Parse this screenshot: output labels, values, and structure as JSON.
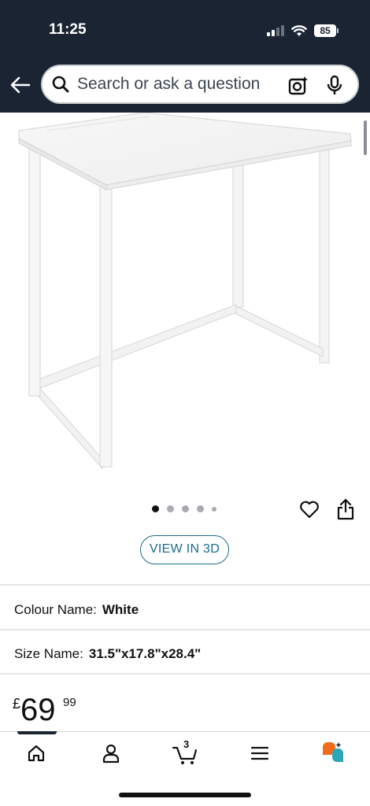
{
  "status_bar": {
    "time": "11:25",
    "battery": "85"
  },
  "search": {
    "placeholder": "Search or ask a question"
  },
  "icons": {
    "back": "arrow-left-icon",
    "search": "search-icon",
    "camera": "camera-lens-icon",
    "mic": "microphone-icon",
    "wishlist": "heart-icon",
    "share": "share-icon",
    "home": "home-icon",
    "account": "person-icon",
    "cart": "cart-icon",
    "menu": "hamburger-menu-icon",
    "rufus": "rufus-assistant-icon"
  },
  "carousel": {
    "total_images": 5,
    "active_index": 0
  },
  "product": {
    "view_3d_label": "VIEW IN 3D",
    "colour": {
      "label": "Colour Name:",
      "value": "White"
    },
    "size": {
      "label": "Size Name:",
      "value": "31.5\"x17.8\"x28.4\""
    },
    "price": {
      "currency": "£",
      "whole": "69",
      "fraction": "99"
    }
  },
  "bottom_nav": {
    "cart_count": "3",
    "active": "home"
  },
  "colors": {
    "header_bg": "#1a2433",
    "link_teal": "#1b6b8c",
    "rufus_orange": "#f26b1d",
    "rufus_teal": "#2aa6b8"
  }
}
